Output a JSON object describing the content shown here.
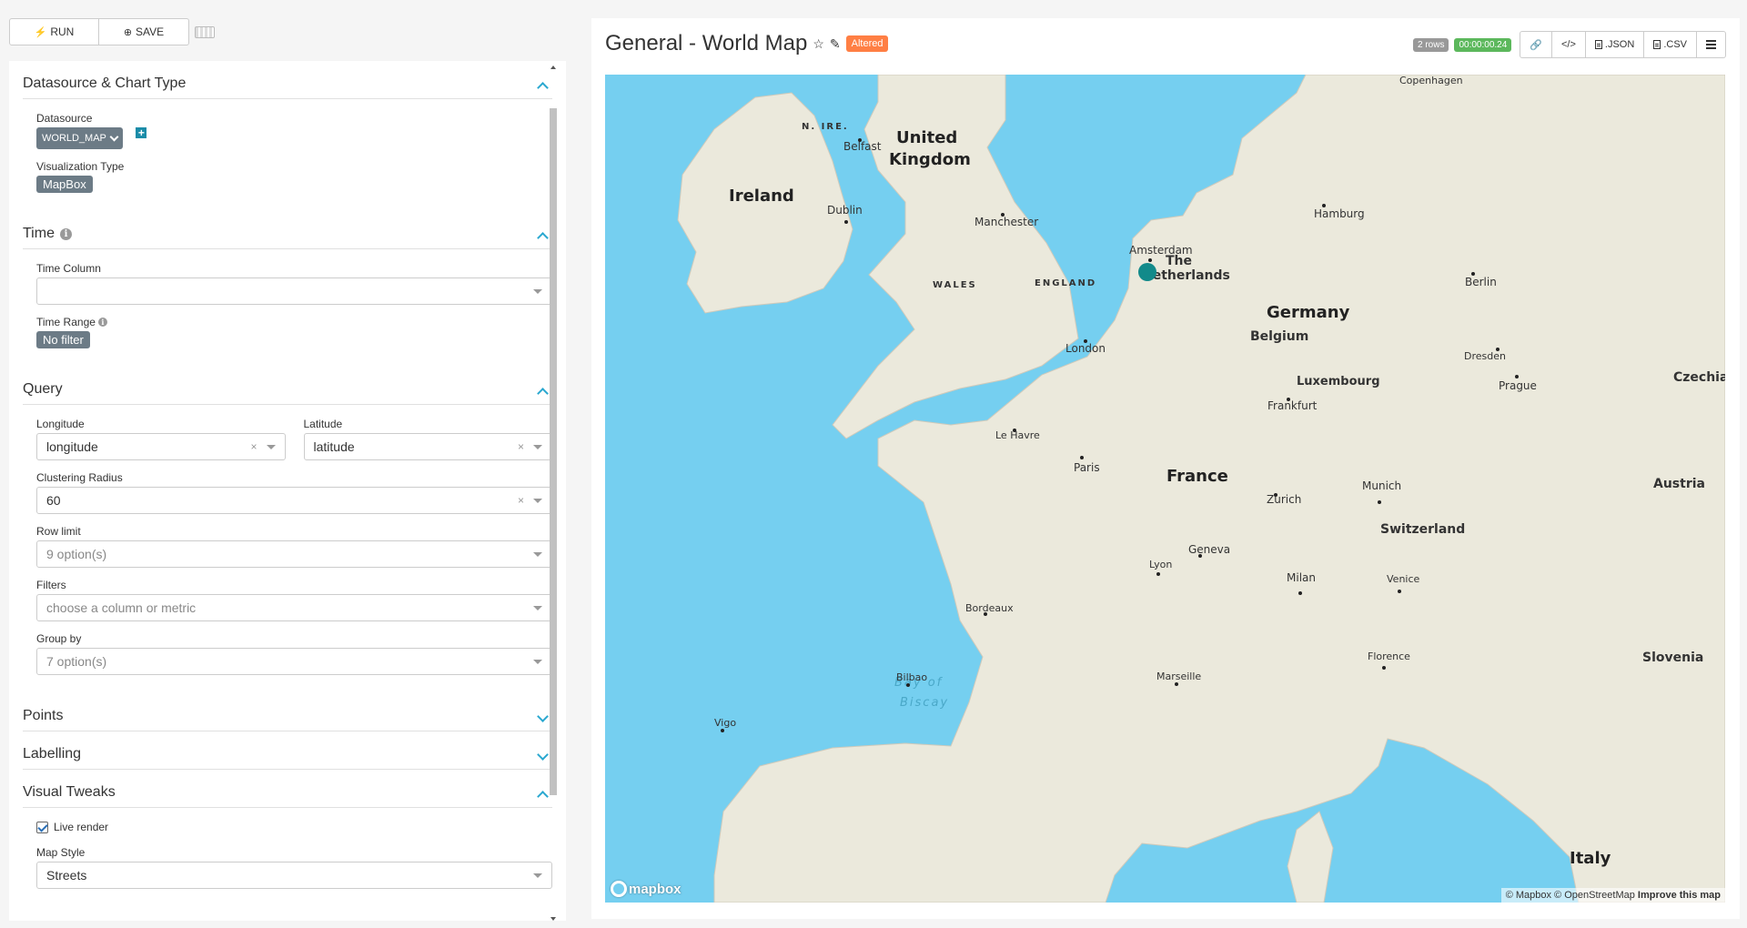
{
  "toolbar": {
    "run_label": "RUN",
    "save_label": "SAVE"
  },
  "sections": {
    "datasource": {
      "title": "Datasource & Chart Type",
      "datasource_label": "Datasource",
      "datasource_value": "WORLD_MAP",
      "viz_label": "Visualization Type",
      "viz_value": "MapBox"
    },
    "time": {
      "title": "Time",
      "time_column_label": "Time Column",
      "time_column_value": "",
      "time_range_label": "Time Range",
      "time_range_value": "No filter"
    },
    "query": {
      "title": "Query",
      "longitude_label": "Longitude",
      "longitude_value": "longitude",
      "latitude_label": "Latitude",
      "latitude_value": "latitude",
      "clustering_label": "Clustering Radius",
      "clustering_value": "60",
      "row_limit_label": "Row limit",
      "row_limit_value": "9 option(s)",
      "filters_label": "Filters",
      "filters_placeholder": "choose a column or metric",
      "group_by_label": "Group by",
      "group_by_value": "7 option(s)"
    },
    "points": {
      "title": "Points"
    },
    "labelling": {
      "title": "Labelling"
    },
    "visual_tweaks": {
      "title": "Visual Tweaks",
      "live_render_label": "Live render",
      "live_render_checked": true,
      "map_style_label": "Map Style",
      "map_style_value": "Streets"
    }
  },
  "chart": {
    "title": "General - World Map",
    "altered_label": "Altered",
    "rows_badge": "2 rows",
    "time_badge": "00:00:00.24",
    "json_label": ".JSON",
    "csv_label": ".CSV",
    "accent_color": "#128a8a"
  },
  "map": {
    "countries": {
      "ireland": "Ireland",
      "uk_line1": "United",
      "uk_line2": "Kingdom",
      "nl_line1": "The",
      "nl_line2": "Netherlands",
      "germany": "Germany",
      "belgium": "Belgium",
      "luxembourg": "Luxembourg",
      "france": "France",
      "switzerland": "Switzerland",
      "austria": "Austria",
      "czechia": "Czechia",
      "slovenia": "Slovenia",
      "italy": "Italy"
    },
    "regions": {
      "nire": "N. IRE.",
      "wales": "WALES",
      "england": "ENGLAND"
    },
    "cities": {
      "belfast": "Belfast",
      "dublin": "Dublin",
      "manchester": "Manchester",
      "london": "London",
      "amsterdam": "Amsterdam",
      "hamburg": "Hamburg",
      "berlin": "Berlin",
      "copenhagen": "Copenhagen",
      "dresden": "Dresden",
      "prague": "Prague",
      "frankfurt": "Frankfurt",
      "le_havre": "Le Havre",
      "paris": "Paris",
      "munich": "Munich",
      "zurich": "Zurich",
      "geneva": "Geneva",
      "lyon": "Lyon",
      "milan": "Milan",
      "venice": "Venice",
      "florence": "Florence",
      "bordeaux": "Bordeaux",
      "bilbao": "Bilbao",
      "marseille": "Marseille",
      "vigo": "Vigo"
    },
    "sea_line1": "Bay of",
    "sea_line2": "Biscay",
    "logo_text": "mapbox",
    "attribution": "© Mapbox © OpenStreetMap",
    "improve_label": "Improve this map"
  }
}
